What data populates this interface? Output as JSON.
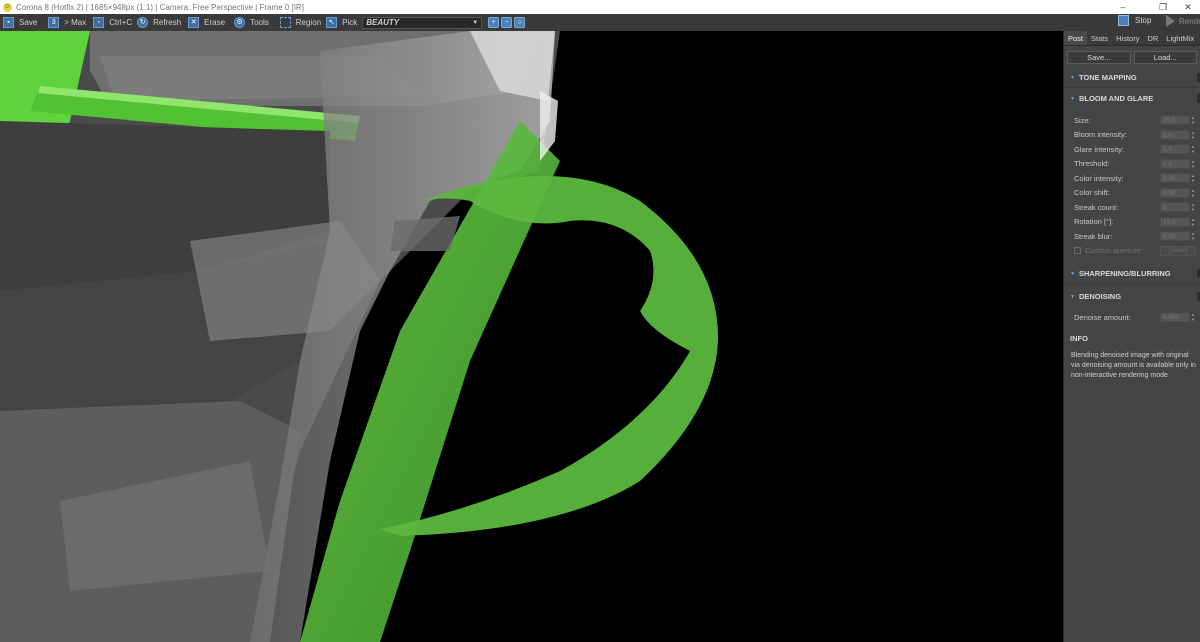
{
  "window": {
    "title": "Corona 8 (Hotfix 2) | 1685×948px (1:1) | Camera: Free Perspective | Frame 0 [IR]",
    "controls": [
      "–",
      "❐",
      "✕"
    ]
  },
  "toolbar": {
    "save": "Save",
    "max": "> Max",
    "copy": "Ctrl+C",
    "refresh": "Refresh",
    "erase": "Erase",
    "tools": "Tools",
    "region": "Region",
    "pick": "Pick",
    "render_pass": "BEAUTY",
    "stop": "Stop",
    "render": "Render"
  },
  "panel": {
    "tabs": [
      "Post",
      "Stats",
      "History",
      "DR",
      "LightMix"
    ],
    "active_tab": "Post",
    "save_button": "Save...",
    "load_button": "Load...",
    "sections": {
      "tone_mapping": "TONE MAPPING",
      "bloom_glare": "BLOOM AND GLARE",
      "sharpening": "SHARPENING/BLURRING",
      "denoising": "DENOISING",
      "info": "INFO"
    },
    "bloom_params": [
      {
        "label": "Size:",
        "value": "15.0"
      },
      {
        "label": "Bloom intensity:",
        "value": "1.0"
      },
      {
        "label": "Glare intensity:",
        "value": "1.0"
      },
      {
        "label": "Threshold:",
        "value": "1.0"
      },
      {
        "label": "Color intensity:",
        "value": "0.30"
      },
      {
        "label": "Color shift:",
        "value": "0.50"
      },
      {
        "label": "Streak count:",
        "value": "3"
      },
      {
        "label": "Rotation [°]:",
        "value": "15.0"
      },
      {
        "label": "Streak blur:",
        "value": "0.20"
      }
    ],
    "custom_aperture": {
      "label": "Custom aperture",
      "button": "[none]"
    },
    "denoise": {
      "label": "Denoise amount:",
      "value": "0.650"
    },
    "info_text": "Blending denoised image with original via denoising amount is available only in non-interactive rendering mode"
  },
  "colors": {
    "accent_blue": "#4b7fba",
    "panel_bg": "#444444",
    "toolbar_bg": "#3a3a3a",
    "green": "#5fd43a"
  }
}
